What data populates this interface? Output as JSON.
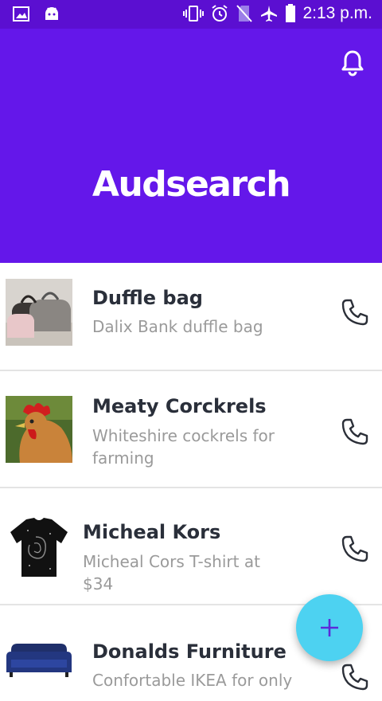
{
  "status_bar": {
    "time": "2:13 p.m.",
    "icons_left": [
      "image-icon",
      "android-icon"
    ],
    "icons_right": [
      "vibrate-icon",
      "alarm-icon",
      "no-sim-icon",
      "airplane-icon",
      "battery-icon"
    ]
  },
  "header": {
    "title": "Audsearch",
    "background": "#6417ea",
    "bell_icon": "bell-icon"
  },
  "items": [
    {
      "title": "Duffle bag",
      "subtitle": "Dalix Bank duffle bag",
      "thumb": "duffle-bag"
    },
    {
      "title": "Meaty Corckrels",
      "subtitle": "Whiteshire cockrels for farming",
      "thumb": "rooster"
    },
    {
      "title": "Micheal Kors",
      "subtitle": "Micheal Cors T-shirt at $34",
      "thumb": "tshirt"
    },
    {
      "title": "Donalds Furniture",
      "subtitle": "Confortable IKEA for only",
      "thumb": "sofa"
    }
  ],
  "fab": {
    "label": "+",
    "color": "#4dd2f1"
  }
}
